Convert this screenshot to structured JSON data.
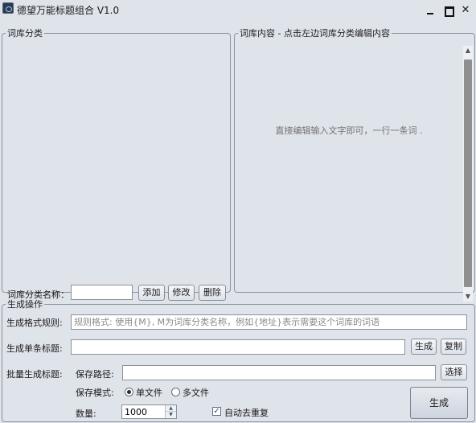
{
  "window": {
    "title": "德望万能标题组合 V1.0",
    "minimize_icon": "minimize-icon",
    "maximize_icon": "maximize-icon",
    "close_glyph": "✕"
  },
  "left_panel": {
    "legend": "词库分类",
    "category_label": "词库分类名称：",
    "category_input_value": "",
    "add_label": "添加",
    "edit_label": "修改",
    "delete_label": "删除"
  },
  "right_panel": {
    "legend": "词库内容 - 点击左边词库分类编辑内容",
    "hint": "直接编辑输入文字即可，一行一条词 ."
  },
  "generate": {
    "legend": "生成操作",
    "rule_label": "生成格式规则:",
    "rule_placeholder": "规则格式: 使用{M}, M为词库分类名称，例如{地址}表示需要这个词库的词语",
    "single_label": "生成单条标题:",
    "single_value": "",
    "single_generate_label": "生成",
    "copy_label": "复制",
    "batch_label": "批量生成标题:",
    "save_path_label": "保存路径:",
    "save_path_value": "",
    "choose_label": "选择",
    "save_mode_label": "保存模式:",
    "mode_single": "单文件",
    "mode_multi": "多文件",
    "selected_mode": "单文件",
    "quantity_label": "数量:",
    "quantity_value": "1000",
    "dedupe_label": "自动去重复",
    "dedupe_checked": true,
    "big_generate_label": "生成"
  }
}
